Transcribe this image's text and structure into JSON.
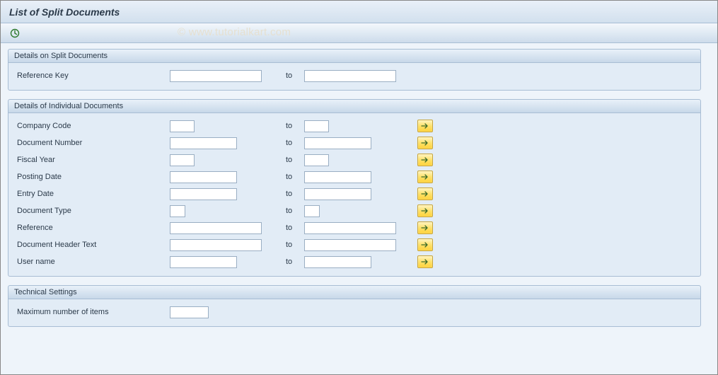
{
  "header": {
    "title": "List of Split Documents"
  },
  "watermark": "© www.tutorialkart.com",
  "labels": {
    "to": "to"
  },
  "groups": {
    "split": {
      "title": "Details on Split Documents",
      "fields": {
        "reference_key": {
          "label": "Reference Key",
          "from": "",
          "to": ""
        }
      }
    },
    "individual": {
      "title": "Details of Individual Documents",
      "fields": {
        "company_code": {
          "label": "Company Code",
          "from": "",
          "to": ""
        },
        "document_number": {
          "label": "Document Number",
          "from": "",
          "to": ""
        },
        "fiscal_year": {
          "label": "Fiscal Year",
          "from": "",
          "to": ""
        },
        "posting_date": {
          "label": "Posting Date",
          "from": "",
          "to": ""
        },
        "entry_date": {
          "label": "Entry Date",
          "from": "",
          "to": ""
        },
        "document_type": {
          "label": "Document Type",
          "from": "",
          "to": ""
        },
        "reference": {
          "label": "Reference",
          "from": "",
          "to": ""
        },
        "doc_header_text": {
          "label": "Document Header Text",
          "from": "",
          "to": ""
        },
        "user_name": {
          "label": "User name",
          "from": "",
          "to": ""
        }
      }
    },
    "technical": {
      "title": "Technical Settings",
      "fields": {
        "max_items": {
          "label": "Maximum number of items",
          "value": ""
        }
      }
    }
  }
}
